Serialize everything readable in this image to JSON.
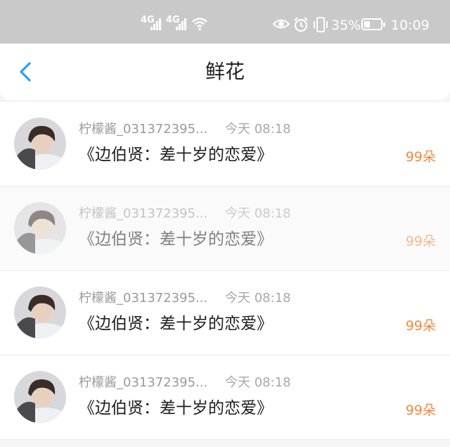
{
  "status_bar": {
    "network1": "4G",
    "network2": "4G",
    "battery_percent": "35%",
    "battery_level": 0.35,
    "time": "10:09",
    "icons": [
      "signal-icon",
      "signal-icon",
      "wifi-icon",
      "eye-icon",
      "alarm-icon",
      "vibrate-icon",
      "battery-icon"
    ]
  },
  "header": {
    "title": "鲜花",
    "back_icon": "back-chevron-icon",
    "accent_color": "#2aa1f0"
  },
  "items": [
    {
      "name": "柠檬酱_031372395...",
      "time": "今天 08:18",
      "book": "《边伯贤：差十岁的恋爱》",
      "count": "99朵",
      "faded": false
    },
    {
      "name": "柠檬酱_031372395...",
      "time": "今天 08:18",
      "book": "《边伯贤：差十岁的恋爱》",
      "count": "99朵",
      "faded": true
    },
    {
      "name": "柠檬酱_031372395...",
      "time": "今天 08:18",
      "book": "《边伯贤：差十岁的恋爱》",
      "count": "99朵",
      "faded": false
    },
    {
      "name": "柠檬酱_031372395...",
      "time": "今天 08:18",
      "book": "《边伯贤：差十岁的恋爱》",
      "count": "99朵",
      "faded": false
    }
  ],
  "colors": {
    "count": "#f08a3c",
    "status_bar_bg": "#c9c9c9"
  }
}
